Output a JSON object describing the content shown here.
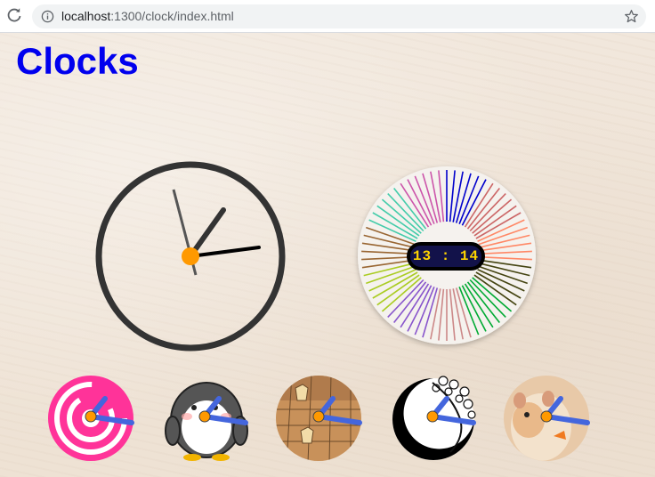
{
  "browser": {
    "url_host": "localhost",
    "url_rest": ":1300/clock/index.html",
    "icons": [
      "reload-icon",
      "site-info-icon",
      "bookmark-star-icon"
    ]
  },
  "page": {
    "title": "Clocks",
    "title_color": "#0000ee"
  },
  "analog_clock": {
    "hour": 13,
    "minute": 14,
    "second": 57,
    "center_color": "#ff9900",
    "ring_color": "#333333"
  },
  "digital_clock": {
    "time_text": "13 : 14",
    "text_color": "#ffd400",
    "background": "#12124a",
    "ray_palette": [
      "#0000cc",
      "#cc6666",
      "#ff8866",
      "#444411",
      "#00aa33",
      "#cc8888",
      "#8855cc",
      "#aacc22",
      "#996633",
      "#44ccaa",
      "#cc55aa"
    ]
  },
  "small_clocks": [
    {
      "name": "target",
      "hand_color": "#4466dd",
      "center_color": "#ff9900"
    },
    {
      "name": "penguin",
      "hand_color": "#4466dd",
      "center_color": "#ff9900"
    },
    {
      "name": "shogi",
      "hand_color": "#4466dd",
      "center_color": "#ff9900"
    },
    {
      "name": "sakura",
      "hand_color": "#4466dd",
      "center_color": "#ff9900"
    },
    {
      "name": "hamster",
      "hand_color": "#4466dd",
      "center_color": "#ff9900"
    }
  ]
}
